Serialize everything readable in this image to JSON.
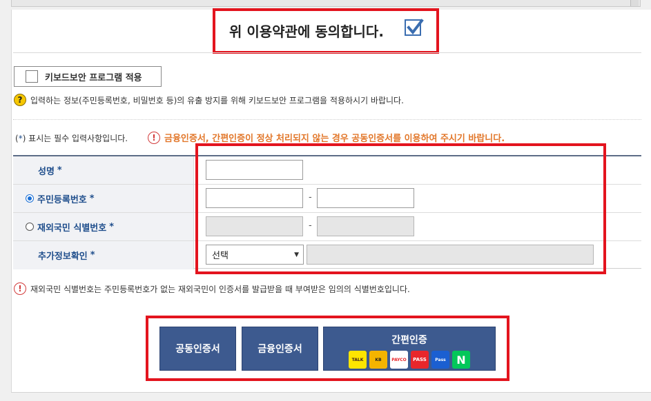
{
  "agreement": {
    "text": "위 이용약관에 동의합니다.",
    "checked": true
  },
  "keyboard_security": {
    "label": "키보드보안 프로그램 적용"
  },
  "help_text": "입력하는 정보(주민등록번호, 비밀번호 등)의 유출 방지를 위해 키보드보안 프로그램을 적용하시기 바랍니다.",
  "required_note": {
    "prefix": "(",
    "star": "*",
    "suffix": ") 표시는 필수 입력사항입니다."
  },
  "warning_text": "금융인증서, 간편인증이 정상 처리되지 않는 경우 공동인증서를 이용하여 주시기 바랍니다.",
  "form": {
    "name_label": "성명",
    "rrn_label": "주민등록번호",
    "foreign_label": "재외국민 식별번호",
    "extra_label": "추가정보확인",
    "star": "*",
    "dash": "-",
    "select_value": "선택"
  },
  "info_text": "재외국민 식별번호는 주민등록번호가 없는 재외국민이 인증서를 발급받을 때 부여받은 임의의 식별번호입니다.",
  "buttons": {
    "joint_cert": "공동인증서",
    "financial_cert": "금융인증서",
    "simple_auth": "간편인증"
  },
  "simple_auth_providers": {
    "kakao": "TALK",
    "kb": "KB",
    "payco": "PAYCO",
    "pass": "PASS",
    "samsung": "Pass",
    "naver": "N"
  },
  "colors": {
    "highlight_red": "#e3141e",
    "button_blue": "#3d5a8f",
    "label_blue": "#1f4e8c",
    "warning_orange": "#e2772a"
  }
}
